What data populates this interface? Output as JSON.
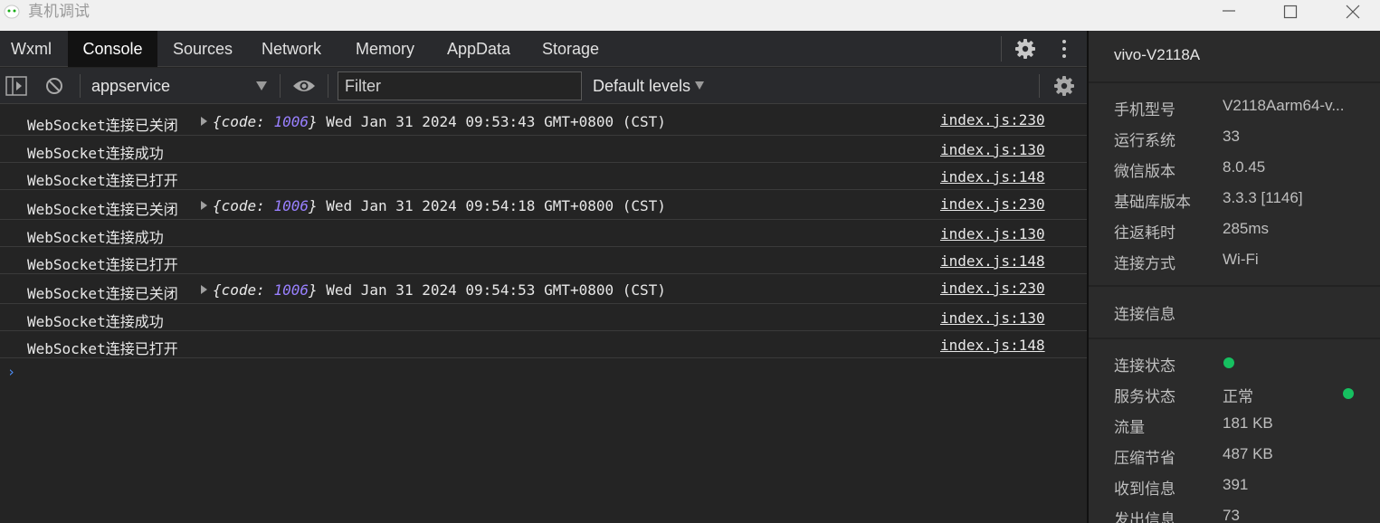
{
  "window": {
    "title": "真机调试",
    "icon": "wechat-devtools-icon"
  },
  "tabs": [
    "Wxml",
    "Console",
    "Sources",
    "Network",
    "Memory",
    "AppData",
    "Storage"
  ],
  "active_tab": "Console",
  "toolbar": {
    "context": "appservice",
    "filter_placeholder": "Filter",
    "levels": "Default levels"
  },
  "console": {
    "rows": [
      {
        "message": "WebSocket连接已关闭",
        "obj_open": "{code: ",
        "code": "1006",
        "obj_close": "}",
        "date": " Wed Jan 31 2024 09:53:43 GMT+0800 (CST)",
        "source": "index.js:230"
      },
      {
        "message": "WebSocket连接成功",
        "source": "index.js:130"
      },
      {
        "message": "WebSocket连接已打开",
        "source": "index.js:148"
      },
      {
        "message": "WebSocket连接已关闭",
        "obj_open": "{code: ",
        "code": "1006",
        "obj_close": "}",
        "date": " Wed Jan 31 2024 09:54:18 GMT+0800 (CST)",
        "source": "index.js:230"
      },
      {
        "message": "WebSocket连接成功",
        "source": "index.js:130"
      },
      {
        "message": "WebSocket连接已打开",
        "source": "index.js:148"
      },
      {
        "message": "WebSocket连接已关闭",
        "obj_open": "{code: ",
        "code": "1006",
        "obj_close": "}",
        "date": " Wed Jan 31 2024 09:54:53 GMT+0800 (CST)",
        "source": "index.js:230"
      },
      {
        "message": "WebSocket连接成功",
        "source": "index.js:130"
      },
      {
        "message": "WebSocket连接已打开",
        "source": "index.js:148"
      }
    ],
    "prompt": "›"
  },
  "device": {
    "name": "vivo-V2118A",
    "info": [
      {
        "label": "手机型号",
        "value": "V2118Aarm64-v..."
      },
      {
        "label": "运行系统",
        "value": "33"
      },
      {
        "label": "微信版本",
        "value": "8.0.45"
      },
      {
        "label": "基础库版本",
        "value": "3.3.3 [1146]"
      },
      {
        "label": "往返耗时",
        "value": "285ms"
      },
      {
        "label": "连接方式",
        "value": "Wi-Fi"
      }
    ],
    "connection_title": "连接信息",
    "connection": [
      {
        "label": "连接状态",
        "value": ""
      },
      {
        "label": "服务状态",
        "value": "正常"
      },
      {
        "label": "流量",
        "value": "181 KB"
      },
      {
        "label": "压缩节省",
        "value": "487 KB"
      },
      {
        "label": "收到信息",
        "value": "391"
      },
      {
        "label": "发出信息",
        "value": "73"
      }
    ],
    "status_color": "#16c060"
  }
}
